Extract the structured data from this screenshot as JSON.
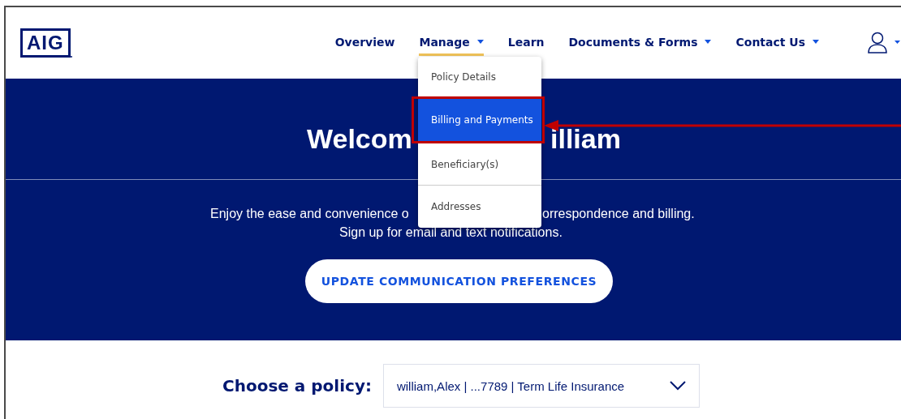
{
  "logo": {
    "text": "AIG"
  },
  "nav": [
    {
      "label": "Overview",
      "selected": false,
      "has_menu": false
    },
    {
      "label": "Manage",
      "selected": true,
      "has_menu": true
    },
    {
      "label": "Learn",
      "selected": false,
      "has_menu": false
    },
    {
      "label": "Documents & Forms",
      "selected": false,
      "has_menu": true
    },
    {
      "label": "Contact Us",
      "selected": false,
      "has_menu": true
    }
  ],
  "manage_menu": [
    {
      "label": "Policy Details",
      "selected": false
    },
    {
      "label": "Billing and Payments",
      "selected": true
    },
    {
      "label": "Beneficiary(s)",
      "selected": false
    },
    {
      "label": "Addresses",
      "selected": false
    }
  ],
  "hero": {
    "heading_parts": [
      "Welcom",
      "illiam"
    ],
    "text_parts": [
      "Enjoy the ease and convenience o",
      "orrespondence and billing."
    ],
    "text_line_2": "Sign up for email and text notifications.",
    "button": "UPDATE COMMUNICATION PREFERENCES"
  },
  "policy": {
    "label": "Choose a policy:",
    "value": "william,Alex | ...7789 | Term Life Insurance"
  }
}
